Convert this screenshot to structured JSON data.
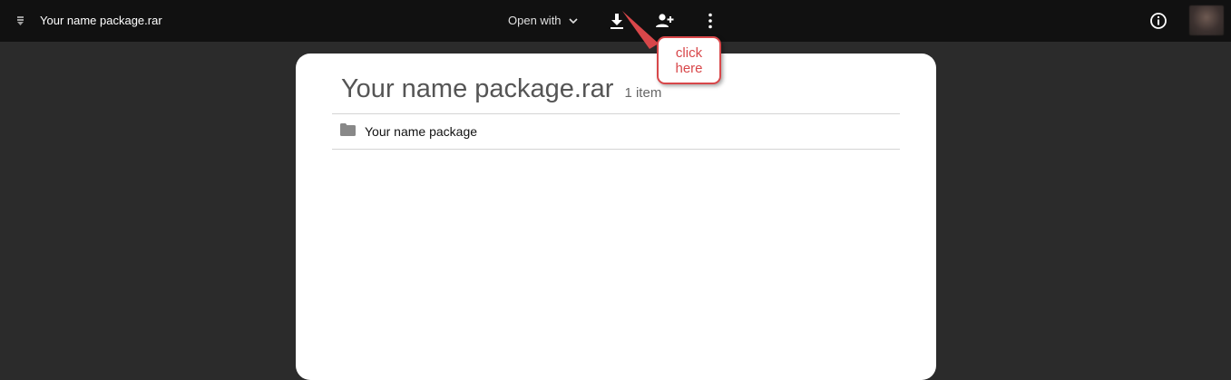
{
  "topbar": {
    "file_icon": "file-menu-icon",
    "file_name": "Your name package.rar",
    "open_with_label": "Open with",
    "actions": {
      "download": "download-icon",
      "share": "add-person-icon",
      "more": "more-vert-icon",
      "details": "info-icon"
    }
  },
  "archive": {
    "title": "Your name package.rar",
    "item_count": "1 item",
    "items": [
      {
        "icon": "folder-icon",
        "name": "Your name package"
      }
    ]
  },
  "annotation": {
    "line1": "click",
    "line2": "here",
    "color": "#d8474a"
  },
  "colors": {
    "topbar_bg": "#111111",
    "viewer_bg": "#2b2b2b",
    "card_bg": "#ffffff"
  }
}
